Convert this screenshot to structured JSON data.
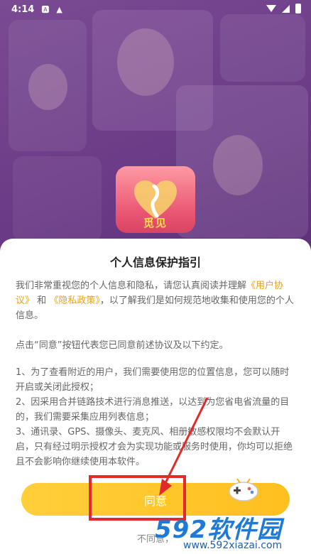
{
  "statusbar": {
    "time": "4:14",
    "icons": [
      "a-icon",
      "warning-icon"
    ],
    "right_icons": [
      "wifi-icon",
      "signal-icon",
      "battery-icon"
    ]
  },
  "app": {
    "name": "觅见"
  },
  "dialog": {
    "title": "个人信息保护指引",
    "intro_part1": "我们非常重视您的个人信息和隐私，请您认真阅读并理解",
    "user_agreement": "《用户协议》",
    "intro_and": "和",
    "privacy_policy": "《隐私政策》",
    "intro_part2": "，以了解我们是如何规范地收集和使用您的个人信息。",
    "notice": "点击“同意”按钮代表您已同意前述协议及以下约定。",
    "items": [
      "1、为了查看附近的用户，我们需要使用您的位置信息，您可以随时开启或关闭此授权；",
      "2、因采用合并链路技术进行消息推送，以达到为您省电省流量的目的，我们需要采集应用列表信息；",
      "3、通讯录、GPS、摄像头、麦克风、相册敏感权限均不会默认开启，只有经过明示授权才会为实现功能或服务时使用，你均可以拒绝且不会影响你继续使用本软件。"
    ],
    "agree_button": "同意",
    "disagree_button": "不同意，"
  },
  "watermark": {
    "big": "592软件园",
    "small": "www.592xiazai.com"
  },
  "colors": {
    "accent": "#FFC22A",
    "link": "#E9A21A",
    "annotation": "#E12A2A"
  }
}
